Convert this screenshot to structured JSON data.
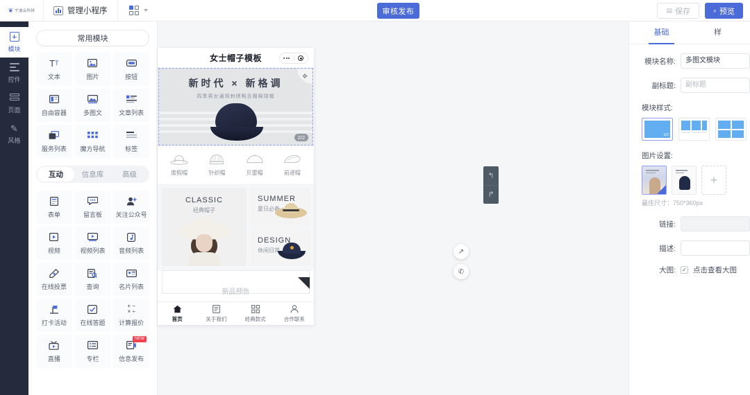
{
  "topbar": {
    "logo_text": "宁波云科技",
    "logo_icon": "brand-logo-icon",
    "manage_label": "管理小程序",
    "manage_icon": "chart-icon",
    "apps_icon": "grid-apps-icon",
    "chevron_icon": "chevron-down-icon",
    "publish_label": "审核发布",
    "save_label": "保存",
    "save_icon": "save-icon",
    "preview_label": "预览",
    "preview_icon": "search-icon"
  },
  "rail": {
    "items": [
      {
        "label": "模块",
        "icon": "plus-square-icon"
      },
      {
        "label": "控件",
        "icon": "sliders-icon"
      },
      {
        "label": "页面",
        "icon": "pages-icon"
      },
      {
        "label": "风格",
        "icon": "wand-icon"
      }
    ]
  },
  "panel": {
    "common_header": "常用模块",
    "common_modules": [
      {
        "label": "文本",
        "icon": "text-icon"
      },
      {
        "label": "图片",
        "icon": "image-icon"
      },
      {
        "label": "按钮",
        "icon": "button-icon"
      },
      {
        "label": "自由容器",
        "icon": "container-icon"
      },
      {
        "label": "多图文",
        "icon": "multi-image-text-icon"
      },
      {
        "label": "文章列表",
        "icon": "article-list-icon"
      },
      {
        "label": "服务列表",
        "icon": "service-list-icon"
      },
      {
        "label": "魔方导航",
        "icon": "magic-nav-icon"
      },
      {
        "label": "标签",
        "icon": "tag-icon"
      }
    ],
    "tabs": [
      {
        "label": "互动",
        "active": true
      },
      {
        "label": "信息库",
        "active": false
      },
      {
        "label": "高级",
        "active": false
      }
    ],
    "advanced_modules": [
      {
        "label": "表单",
        "icon": "form-icon"
      },
      {
        "label": "留言板",
        "icon": "message-board-icon"
      },
      {
        "label": "关注公众号",
        "icon": "follow-account-icon"
      },
      {
        "label": "视频",
        "icon": "video-icon"
      },
      {
        "label": "视频列表",
        "icon": "video-list-icon"
      },
      {
        "label": "音频列表",
        "icon": "audio-list-icon"
      },
      {
        "label": "在线投票",
        "icon": "vote-icon"
      },
      {
        "label": "查询",
        "icon": "query-icon"
      },
      {
        "label": "名片列表",
        "icon": "card-list-icon"
      },
      {
        "label": "打卡活动",
        "icon": "checkin-icon"
      },
      {
        "label": "在线答题",
        "icon": "quiz-icon"
      },
      {
        "label": "计算报价",
        "icon": "calculator-icon"
      },
      {
        "label": "直播",
        "icon": "live-icon"
      },
      {
        "label": "专栏",
        "icon": "column-icon"
      },
      {
        "label": "信息发布",
        "icon": "publish-info-icon",
        "badge": "NEW"
      }
    ]
  },
  "preview": {
    "page_title": "女士帽子模板",
    "capsule_icons": [
      "more-dots-icon",
      "target-icon"
    ],
    "banner": {
      "title": "新时代 × 新格调",
      "subtitle": "四季男女通用刺绣鸭舌帽棉球帽",
      "page_indicator": "2/2",
      "drag_icon": "move-handle-icon"
    },
    "nav_items": [
      {
        "label": "度假帽",
        "icon": "fedora-hat-icon"
      },
      {
        "label": "针织帽",
        "icon": "beanie-hat-icon"
      },
      {
        "label": "贝雷帽",
        "icon": "beret-hat-icon"
      },
      {
        "label": "前进帽",
        "icon": "newsboy-hat-icon"
      }
    ],
    "cards": [
      {
        "en": "CLASSIC",
        "cn": "经典帽子"
      },
      {
        "en": "SUMMER",
        "cn": "夏日必备"
      },
      {
        "en": "DESIGN",
        "cn": "休闲日常"
      }
    ],
    "white_card_text": "新品预告",
    "fabs": [
      {
        "icon": "share-icon"
      },
      {
        "icon": "phone-icon"
      }
    ],
    "tabbar": [
      {
        "label": "首页",
        "icon": "home-icon",
        "active": true
      },
      {
        "label": "关于我们",
        "icon": "doc-icon",
        "active": false
      },
      {
        "label": "经典款式",
        "icon": "grid-icon",
        "active": false
      },
      {
        "label": "合作联系",
        "icon": "user-icon",
        "active": false
      }
    ],
    "history": {
      "undo_icon": "undo-arrow-icon",
      "redo_icon": "redo-arrow-icon"
    }
  },
  "settings": {
    "tabs": [
      {
        "label": "基础",
        "active": true
      },
      {
        "label": "样",
        "active": false
      }
    ],
    "module_name_label": "模块名称:",
    "module_name_value": "多图文模块",
    "subtitle_label": "副标题:",
    "subtitle_value": "副标题",
    "style_label": "模块样式:",
    "style_options": [
      {
        "name": "one-half",
        "badge": "1/2",
        "selected": true
      },
      {
        "name": "three-column",
        "badge": "",
        "selected": false
      },
      {
        "name": "four-grid",
        "badge": "",
        "selected": false
      }
    ],
    "image_settings_label": "图片设置:",
    "image_hint": "最佳尺寸：750*360px",
    "add_image_icon": "plus-icon",
    "link_label": "链接:",
    "link_value": "",
    "desc_label": "描述:",
    "desc_value": "",
    "bigimg_label": "大图:",
    "bigimg_checkbox_label": "点击查看大图",
    "bigimg_checked": true
  },
  "colors": {
    "accent": "#4a6bd8",
    "rail_bg": "#252b3d",
    "canvas_bg": "#f5f6f8",
    "badge_red": "#f5414f"
  }
}
